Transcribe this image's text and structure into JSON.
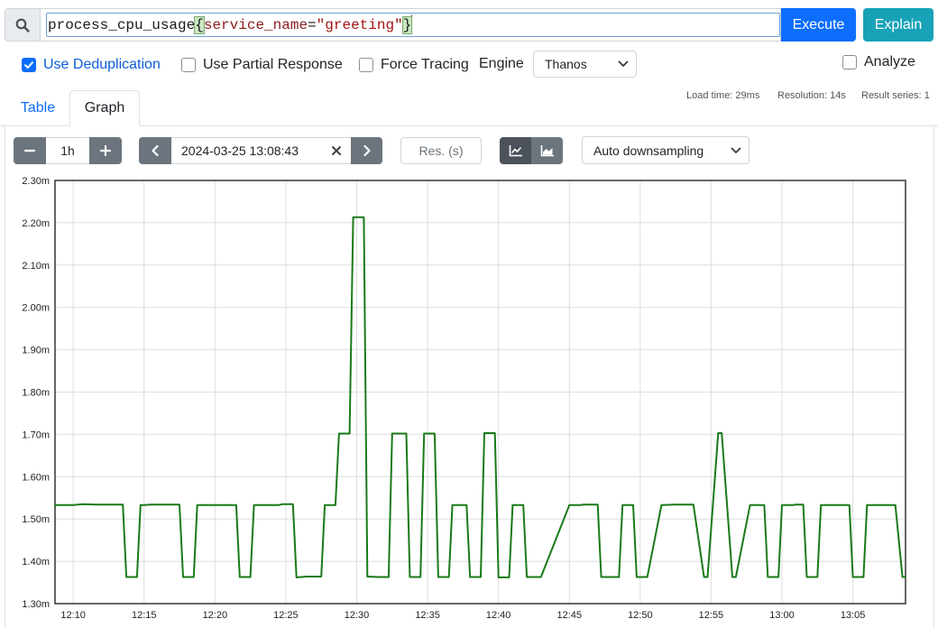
{
  "query": {
    "metric": "process_cpu_usage",
    "label_key": "service_name",
    "label_value": "\"greeting\"",
    "open_brace": "{",
    "close_brace": "}",
    "equals": "="
  },
  "buttons": {
    "execute": "Execute",
    "explain": "Explain"
  },
  "options": {
    "use_deduplication": {
      "label": "Use Deduplication",
      "checked": true
    },
    "use_partial_response": {
      "label": "Use Partial Response",
      "checked": false
    },
    "force_tracing": {
      "label": "Force Tracing",
      "checked": false
    },
    "engine_label": "Engine",
    "engine_value": "Thanos",
    "analyze": {
      "label": "Analyze",
      "checked": false
    }
  },
  "stats": {
    "load_time": "Load time: 29ms",
    "resolution": "Resolution: 14s",
    "result_series": "Result series: 1"
  },
  "tabs": [
    {
      "label": "Table",
      "active": false
    },
    {
      "label": "Graph",
      "active": true
    }
  ],
  "graph_controls": {
    "range": "1h",
    "end_time": "2024-03-25 13:08:43",
    "res_placeholder": "Res. (s)",
    "downsampling": "Auto downsampling"
  },
  "colors": {
    "series": "#197a19",
    "primary": "#0d6efd",
    "info": "#17a2b8",
    "secondary": "#6c757d"
  },
  "chart_data": {
    "type": "line",
    "ylim": [
      1.3,
      2.3
    ],
    "yticks": [
      2.3,
      2.2,
      2.1,
      2.0,
      1.9,
      1.8,
      1.7,
      1.6,
      1.5,
      1.4,
      1.3
    ],
    "ytick_labels": [
      "2.30m",
      "2.20m",
      "2.10m",
      "2.00m",
      "1.90m",
      "1.80m",
      "1.70m",
      "1.60m",
      "1.50m",
      "1.40m",
      "1.30m"
    ],
    "xlim": [
      "12:08:43",
      "13:08:43"
    ],
    "xticks": [
      "12:10",
      "12:15",
      "12:20",
      "12:25",
      "12:30",
      "12:35",
      "12:40",
      "12:45",
      "12:50",
      "12:55",
      "13:00",
      "13:05"
    ],
    "series": [
      {
        "x": [
          "12:08:43",
          "12:10:00",
          "12:10:40",
          "12:11:40",
          "12:12:15",
          "12:13:30",
          "12:13:45",
          "12:14:30",
          "12:14:45",
          "12:15:00",
          "12:15:30",
          "12:16:30",
          "12:17:30",
          "12:17:45",
          "12:18:30",
          "12:18:45",
          "12:19:00",
          "12:21:00",
          "12:21:30",
          "12:21:45",
          "12:22:30",
          "12:22:45",
          "12:23:00",
          "12:24:30",
          "12:24:45",
          "12:25:30",
          "12:25:45",
          "12:26:30",
          "12:27:30",
          "12:27:45",
          "12:28:30",
          "12:28:45",
          "12:29:30",
          "12:29:45",
          "12:30:30",
          "12:30:45",
          "12:31:30",
          "12:32:15",
          "12:32:30",
          "12:33:30",
          "12:33:45",
          "12:34:30",
          "12:34:45",
          "12:35:30",
          "12:35:45",
          "12:36:30",
          "12:36:45",
          "12:37:45",
          "12:38:00",
          "12:38:45",
          "12:39:00",
          "12:39:45",
          "12:40:00",
          "12:40:45",
          "12:41:00",
          "12:41:45",
          "12:42:00",
          "12:43:00",
          "12:45:00",
          "12:45:45",
          "12:46:00",
          "12:47:00",
          "12:47:15",
          "12:48:30",
          "12:48:45",
          "12:49:30",
          "12:49:45",
          "12:50:30",
          "12:51:30",
          "12:52:30",
          "12:53:30",
          "12:53:45",
          "12:54:30",
          "12:54:45",
          "12:55:30",
          "12:55:45",
          "12:56:30",
          "12:56:45",
          "12:57:45",
          "12:58:00",
          "12:58:45",
          "12:59:00",
          "12:59:45",
          "13:00:00",
          "13:00:45",
          "13:01:00",
          "13:01:30",
          "13:01:45",
          "13:02:30",
          "13:02:45",
          "13:03:45",
          "13:04:00",
          "13:04:45",
          "13:05:00",
          "13:05:45",
          "13:06:00",
          "13:06:45",
          "13:07:00",
          "13:08:00",
          "13:08:30",
          "13:08:43"
        ],
        "y": [
          1.533,
          1.533,
          1.535,
          1.534,
          1.534,
          1.534,
          1.363,
          1.363,
          1.533,
          1.533,
          1.534,
          1.534,
          1.534,
          1.363,
          1.363,
          1.533,
          1.533,
          1.533,
          1.533,
          1.363,
          1.363,
          1.533,
          1.533,
          1.533,
          1.535,
          1.535,
          1.362,
          1.364,
          1.364,
          1.533,
          1.533,
          1.702,
          1.702,
          2.213,
          2.213,
          1.364,
          1.363,
          1.363,
          1.702,
          1.702,
          1.363,
          1.363,
          1.702,
          1.702,
          1.363,
          1.363,
          1.533,
          1.533,
          1.363,
          1.363,
          1.703,
          1.703,
          1.362,
          1.362,
          1.533,
          1.533,
          1.363,
          1.363,
          1.533,
          1.533,
          1.534,
          1.534,
          1.363,
          1.363,
          1.533,
          1.533,
          1.363,
          1.363,
          1.533,
          1.534,
          1.534,
          1.534,
          1.363,
          1.363,
          1.703,
          1.703,
          1.363,
          1.363,
          1.533,
          1.533,
          1.533,
          1.363,
          1.363,
          1.533,
          1.533,
          1.534,
          1.534,
          1.363,
          1.363,
          1.533,
          1.533,
          1.533,
          1.533,
          1.363,
          1.363,
          1.533,
          1.533,
          1.533,
          1.533,
          1.363,
          1.363
        ]
      }
    ],
    "grid": true,
    "legend": "none"
  }
}
